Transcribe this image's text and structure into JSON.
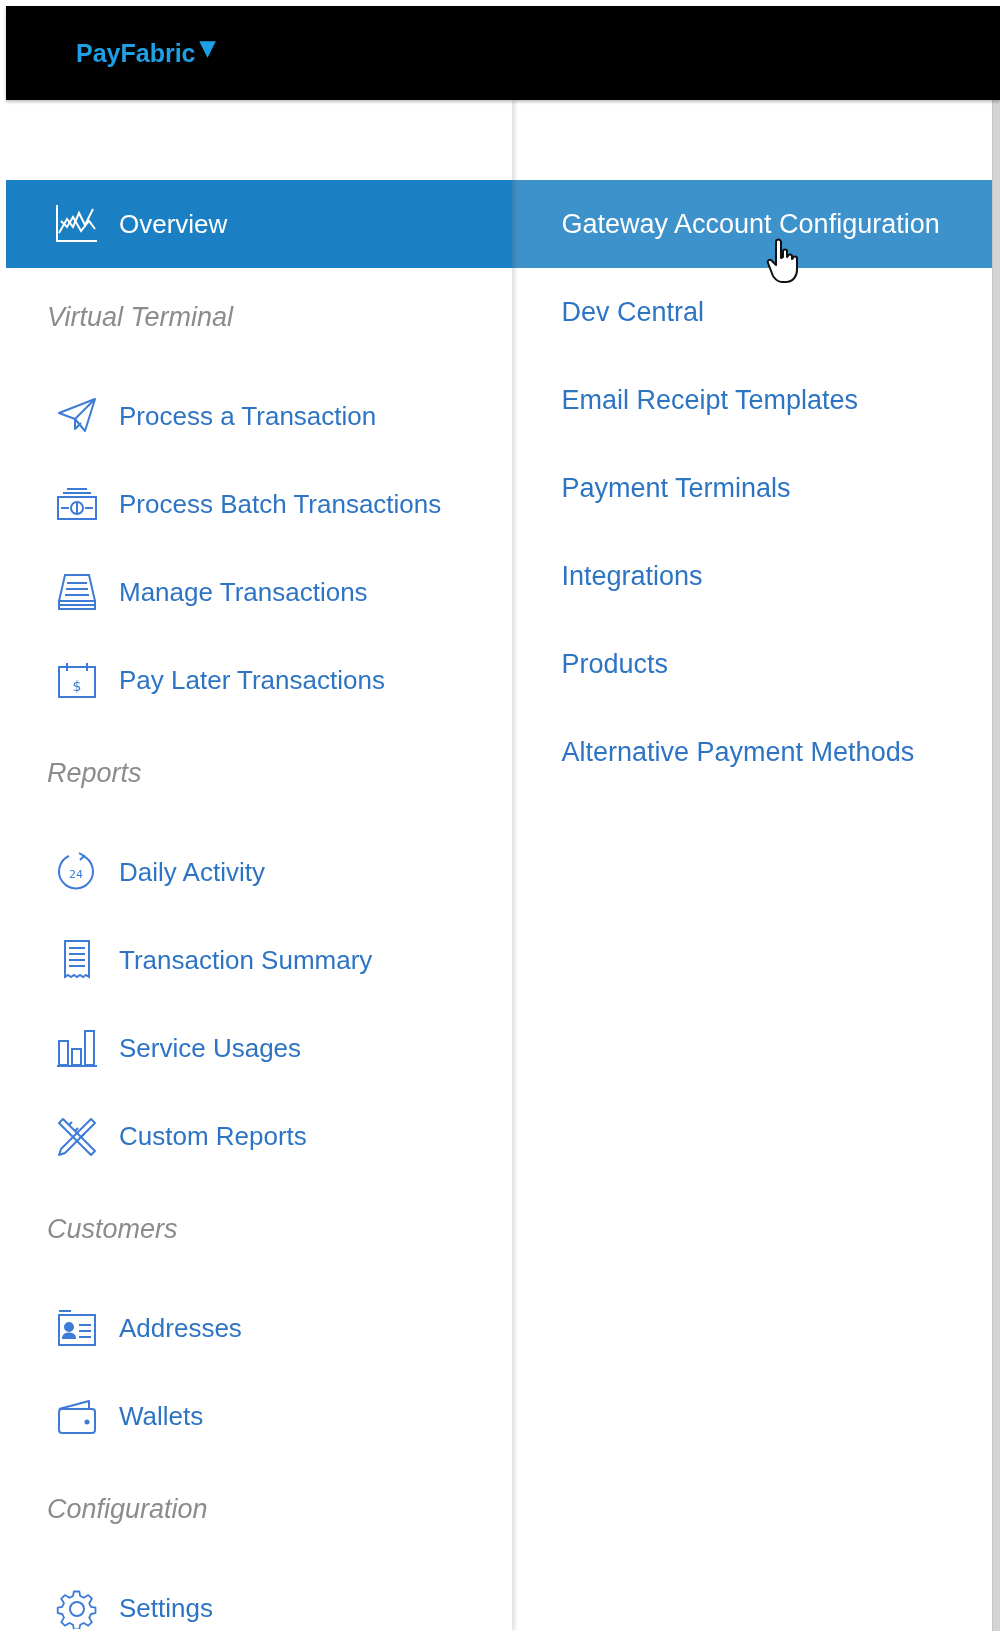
{
  "header": {
    "brand": "PayFabric",
    "brand_caret": "▾"
  },
  "main_menu": [
    {
      "kind": "link",
      "label": "Overview",
      "selected": true
    },
    {
      "kind": "section",
      "label": "Virtual Terminal"
    },
    {
      "kind": "link",
      "label": "Process a Transaction",
      "selected": false
    },
    {
      "kind": "link",
      "label": "Process Batch Transactions",
      "selected": false
    },
    {
      "kind": "link",
      "label": "Manage Transactions",
      "selected": false
    },
    {
      "kind": "link",
      "label": "Pay Later Transactions",
      "selected": false,
      "icon_text": "$"
    },
    {
      "kind": "section",
      "label": "Reports"
    },
    {
      "kind": "link",
      "label": "Daily Activity",
      "selected": false,
      "icon_text": "24"
    },
    {
      "kind": "link",
      "label": "Transaction Summary",
      "selected": false
    },
    {
      "kind": "link",
      "label": "Service Usages",
      "selected": false
    },
    {
      "kind": "link",
      "label": "Custom Reports",
      "selected": false
    },
    {
      "kind": "section",
      "label": "Customers"
    },
    {
      "kind": "link",
      "label": "Addresses",
      "selected": false
    },
    {
      "kind": "link",
      "label": "Wallets",
      "selected": false
    },
    {
      "kind": "section",
      "label": "Configuration"
    },
    {
      "kind": "link",
      "label": "Settings",
      "selected": false
    }
  ],
  "submenu": [
    {
      "label": "Gateway Account Configuration",
      "highlighted": true
    },
    {
      "label": "Dev Central",
      "highlighted": false
    },
    {
      "label": "Email Receipt Templates",
      "highlighted": false
    },
    {
      "label": "Payment Terminals",
      "highlighted": false
    },
    {
      "label": "Integrations",
      "highlighted": false
    },
    {
      "label": "Products",
      "highlighted": false
    },
    {
      "label": "Alternative Payment Methods",
      "highlighted": false
    }
  ]
}
